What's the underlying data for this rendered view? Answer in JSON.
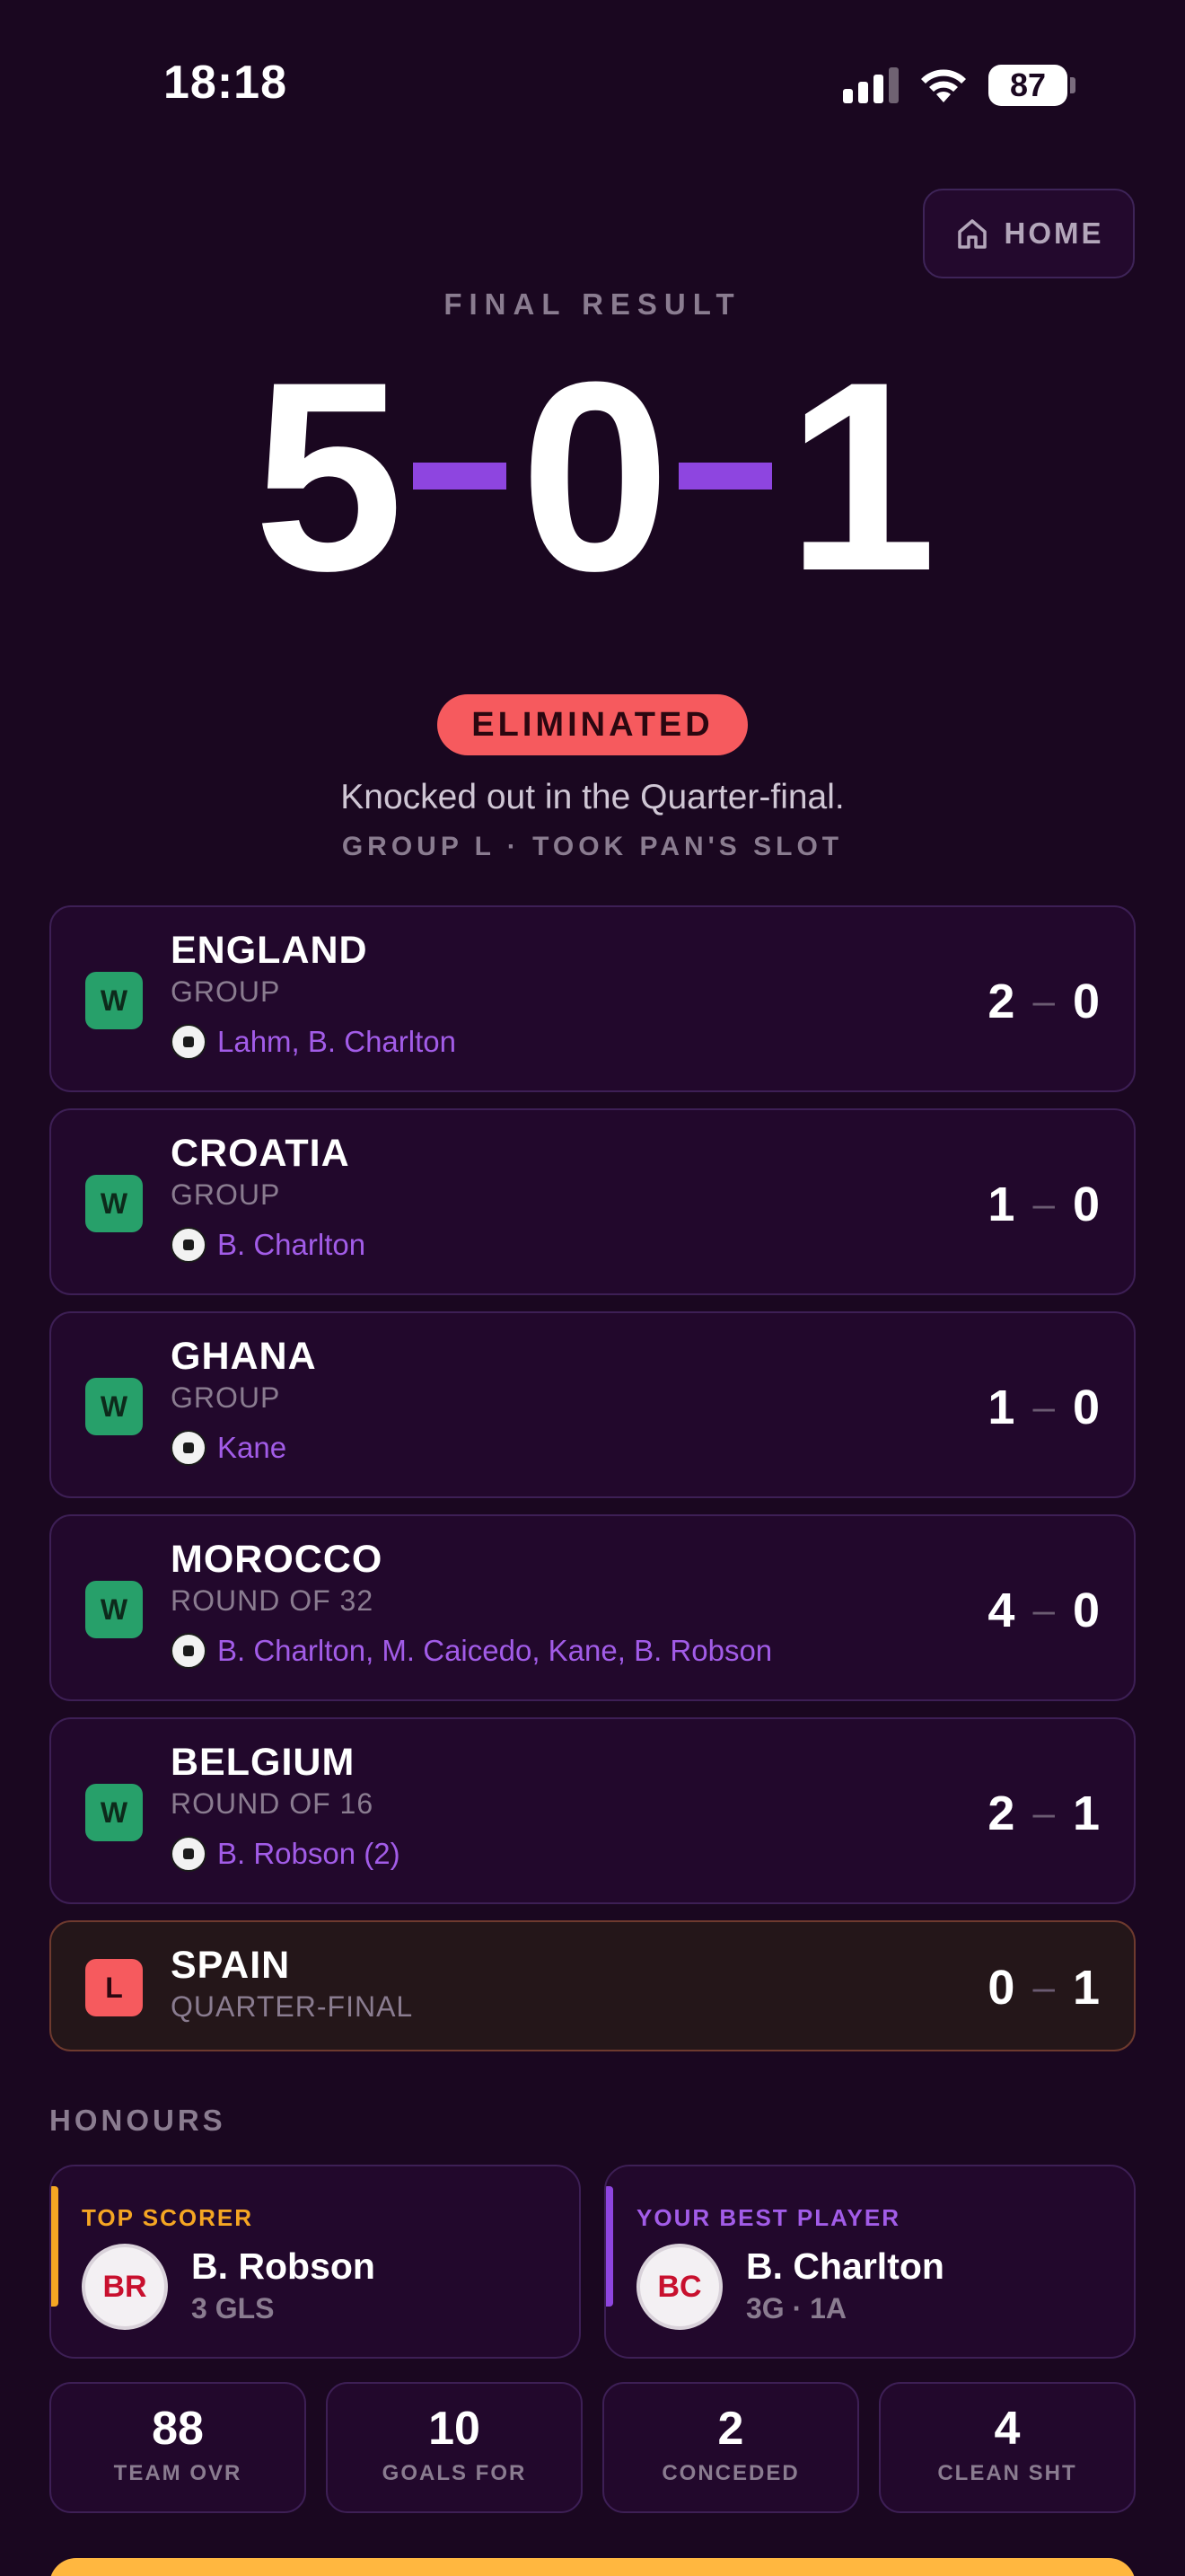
{
  "status_bar": {
    "time": "18:18",
    "battery": "87"
  },
  "header": {
    "home_label": "HOME"
  },
  "result": {
    "label": "FINAL RESULT",
    "wins": "5",
    "draws": "0",
    "losses": "1",
    "badge": "ELIMINATED",
    "description": "Knocked out in the Quarter-final.",
    "subline": "GROUP L · TOOK PAN'S SLOT"
  },
  "matches": [
    {
      "result": "W",
      "opponent": "ENGLAND",
      "stage": "GROUP",
      "scorers": "Lahm, B. Charlton",
      "goals_for": "2",
      "goals_against": "0"
    },
    {
      "result": "W",
      "opponent": "CROATIA",
      "stage": "GROUP",
      "scorers": "B. Charlton",
      "goals_for": "1",
      "goals_against": "0"
    },
    {
      "result": "W",
      "opponent": "GHANA",
      "stage": "GROUP",
      "scorers": "Kane",
      "goals_for": "1",
      "goals_against": "0"
    },
    {
      "result": "W",
      "opponent": "MOROCCO",
      "stage": "ROUND OF 32",
      "scorers": "B. Charlton, M. Caicedo, Kane, B. Robson",
      "goals_for": "4",
      "goals_against": "0"
    },
    {
      "result": "W",
      "opponent": "BELGIUM",
      "stage": "ROUND OF 16",
      "scorers": "B. Robson (2)",
      "goals_for": "2",
      "goals_against": "1"
    },
    {
      "result": "L",
      "opponent": "SPAIN",
      "stage": "QUARTER-FINAL",
      "goals_for": "0",
      "goals_against": "1"
    }
  ],
  "score_separator": "–",
  "honours": {
    "title": "HONOURS",
    "top_scorer": {
      "label": "TOP SCORER",
      "initials": "BR",
      "name": "B. Robson",
      "meta": "3 GLS",
      "accent": "#f5a623"
    },
    "best_player": {
      "label": "YOUR BEST PLAYER",
      "initials": "BC",
      "name": "B. Charlton",
      "meta": "3G · 1A",
      "accent": "#8e45e0"
    }
  },
  "stats": [
    {
      "value": "88",
      "label": "TEAM OVR"
    },
    {
      "value": "10",
      "label": "GOALS FOR"
    },
    {
      "value": "2",
      "label": "CONCEDED"
    },
    {
      "value": "4",
      "label": "CLEAN SHT"
    }
  ],
  "colors": {
    "background": "#1a0720",
    "accent_purple": "#8e45e0",
    "win_green": "#27a06a",
    "loss_red": "#f65a5e",
    "cta_yellow": "#ffb740"
  }
}
